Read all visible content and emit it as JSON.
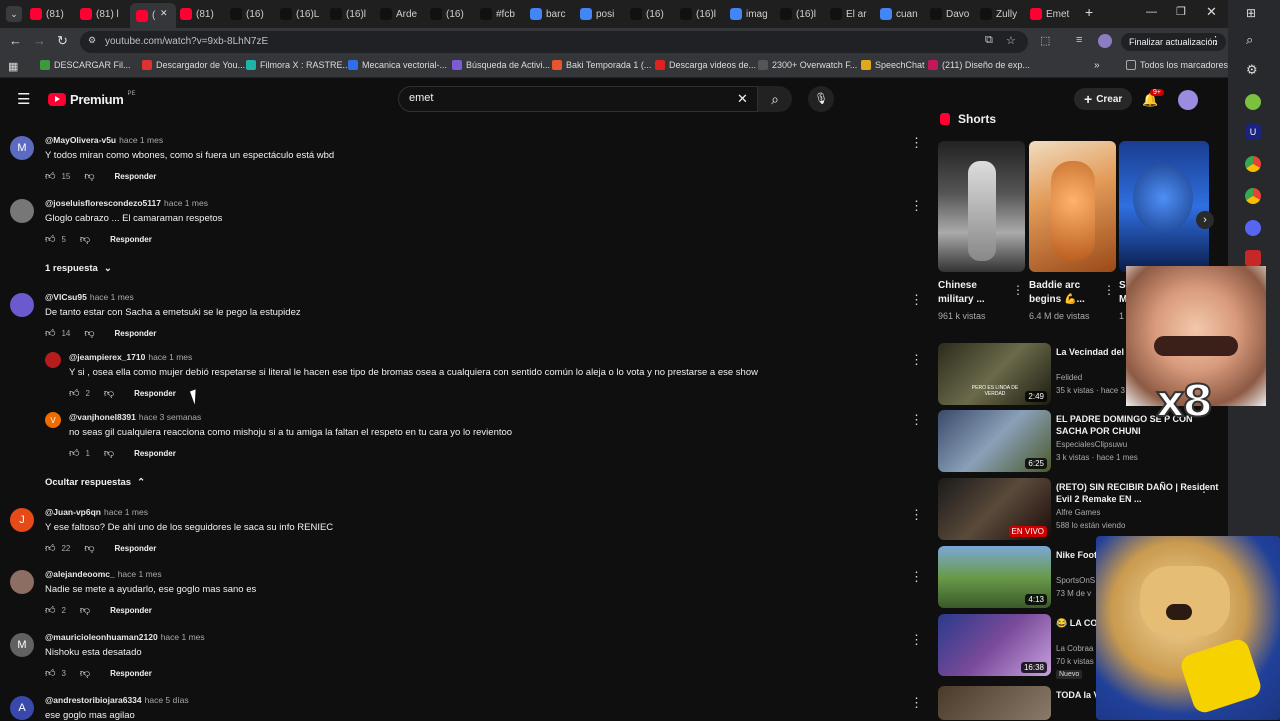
{
  "tabs": [
    {
      "label": "(81)",
      "color": "#ff0033"
    },
    {
      "label": "(81) l",
      "color": "#ff0033"
    },
    {
      "label": "(",
      "color": "#ff0033"
    },
    {
      "label": "(81)",
      "color": "#ff0033"
    },
    {
      "label": "(16)",
      "color": "#111"
    },
    {
      "label": "(16)L",
      "color": "#111"
    },
    {
      "label": "(16)l",
      "color": "#111"
    },
    {
      "label": "Arde",
      "color": "#111"
    },
    {
      "label": "(16)",
      "color": "#111"
    },
    {
      "label": "#fcb",
      "color": "#111"
    },
    {
      "label": "barc",
      "color": "#4285f4"
    },
    {
      "label": "posi",
      "color": "#4285f4"
    },
    {
      "label": "(16)",
      "color": "#111"
    },
    {
      "label": "(16)l",
      "color": "#111"
    },
    {
      "label": "imag",
      "color": "#4285f4"
    },
    {
      "label": "(16)l",
      "color": "#111"
    },
    {
      "label": "El ar",
      "color": "#111"
    },
    {
      "label": "cuan",
      "color": "#4285f4"
    },
    {
      "label": "Davo",
      "color": "#111"
    },
    {
      "label": "Zully",
      "color": "#111"
    },
    {
      "label": "Emet",
      "color": "#ff0033"
    }
  ],
  "address": {
    "url": "youtube.com/watch?v=9xb-8LhN7zE",
    "update_button": "Finalizar actualización"
  },
  "bookmarks": [
    {
      "label": "DESCARGAR Fil...",
      "color": "#3c9a3c"
    },
    {
      "label": "Descargador de You...",
      "color": "#d33"
    },
    {
      "label": "Filmora X : RASTRE...",
      "color": "#1fb5a6"
    },
    {
      "label": "Mecanica vectorial-...",
      "color": "#2f6ee6"
    },
    {
      "label": "Búsqueda de Activi...",
      "color": "#7b5bd6"
    },
    {
      "label": "Baki Temporada 1 (...",
      "color": "#e8542c"
    },
    {
      "label": "Descarga videos de...",
      "color": "#d22"
    },
    {
      "label": "2300+ Overwatch F...",
      "color": "#555"
    },
    {
      "label": "SpeechChat",
      "color": "#e0a81c"
    },
    {
      "label": "(211) Diseño de exp...",
      "color": "#c2185b"
    }
  ],
  "all_bookmarks": "Todos los marcadores",
  "yt": {
    "logo": "Premium",
    "logo_region": "PE",
    "search_value": "emet",
    "create": "Crear",
    "notif_count": "9+"
  },
  "comments": [
    {
      "user": "@MayOlivera-v5u",
      "time": "hace 1 mes",
      "text": "Y todos miran como wbones, como si fuera un espectáculo está wbd",
      "likes": "15",
      "reply": "Responder",
      "avatar": "M",
      "avcolor": "#5c6bc0"
    },
    {
      "user": "@joseluisflorescondezo5117",
      "time": "hace 1 mes",
      "text": "Gloglo cabrazo ... El camaraman respetos",
      "likes": "5",
      "reply": "Responder",
      "avatar": "",
      "avcolor": "#777"
    },
    {
      "user": "@VICsu95",
      "time": "hace 1 mes",
      "text": "De tanto estar con Sacha a emetsuki se le pego la estupidez",
      "likes": "14",
      "reply": "Responder",
      "avatar": "",
      "avcolor": "#6a5acd"
    },
    {
      "user": "@Juan-vp6qn",
      "time": "hace 1 mes",
      "text": "Y ese faltoso? De ahí uno de los seguidores le saca su info RENIEC",
      "likes": "22",
      "reply": "Responder",
      "avatar": "J",
      "avcolor": "#e64a19"
    },
    {
      "user": "@alejandeoomc_",
      "time": "hace 1 mes",
      "text": "Nadie se mete a ayudarlo, ese goglo mas sano es",
      "likes": "2",
      "reply": "Responder",
      "avatar": "",
      "avcolor": "#8d6e63"
    },
    {
      "user": "@mauricioleonhuaman2120",
      "time": "hace 1 mes",
      "text": "Nishoku esta desatado",
      "likes": "3",
      "reply": "Responder",
      "avatar": "M",
      "avcolor": "#616161"
    },
    {
      "user": "@andrestoribiojara6334",
      "time": "hace 5 días",
      "text": "ese goglo mas agilao",
      "avatar": "A",
      "avcolor": "#3949ab"
    }
  ],
  "replies_toggle": {
    "show": "1 respuesta",
    "hide": "Ocultar respuestas"
  },
  "replies": [
    {
      "user": "@jeampierex_1710",
      "time": "hace 1 mes",
      "text": "Y si , osea ella como mujer debió respetarse si literal le hacen ese tipo de bromas osea a cualquiera con sentido común lo aleja o lo vota y no prestarse a ese show",
      "likes": "2",
      "reply": "Responder",
      "avatar": "",
      "avcolor": "#b71c1c"
    },
    {
      "user": "@vanjhonel8391",
      "time": "hace 3 semanas",
      "text": "no seas gil cualquiera reacciona como mishoju si a tu amiga la faltan el respeto en tu cara yo lo revientoo",
      "likes": "1",
      "reply": "Responder",
      "avatar": "V",
      "avcolor": "#ef6c00"
    }
  ],
  "shorts": {
    "heading": "Shorts",
    "items": [
      {
        "title": "Chinese military ...",
        "views": "961 k vistas"
      },
      {
        "title": "Baddie arc begins 💪...",
        "views": "6.4 M de vistas"
      },
      {
        "title": "S M",
        "views": "1"
      }
    ]
  },
  "related": [
    {
      "title": "La Vecindad del Chavo (PARODIA)",
      "channel": "Felided",
      "meta": "35 k vistas · hace 3",
      "duration": "2:49",
      "thumb_text": "PERO ES LINDA DE VERDAD"
    },
    {
      "title": "EL PADRE DOMINGO SE P CON SACHA POR CHUNI",
      "channel": "EspecialesClipsuwu",
      "meta": "3 k vistas · hace 1 mes",
      "duration": "6:25"
    },
    {
      "title": "(RETO) SIN RECIBIR DAÑO | Resident Evil 2 Remake EN ...",
      "channel": "Alfre Games",
      "meta": "588 lo están viendo",
      "duration": "EN VIVO"
    },
    {
      "title": "Nike Foot",
      "channel": "SportsOnS",
      "meta": "73 M de v",
      "duration": "4:13"
    },
    {
      "title": "😂 LA CO LOS MEM",
      "channel": "La Cobraa",
      "meta": "70 k vistas",
      "badge": "Nuevo",
      "duration": "16:38"
    },
    {
      "title": "TODA la V se ROMP",
      "channel": "",
      "meta": "",
      "duration": ""
    }
  ],
  "overlay": {
    "multiplier": "x8"
  }
}
